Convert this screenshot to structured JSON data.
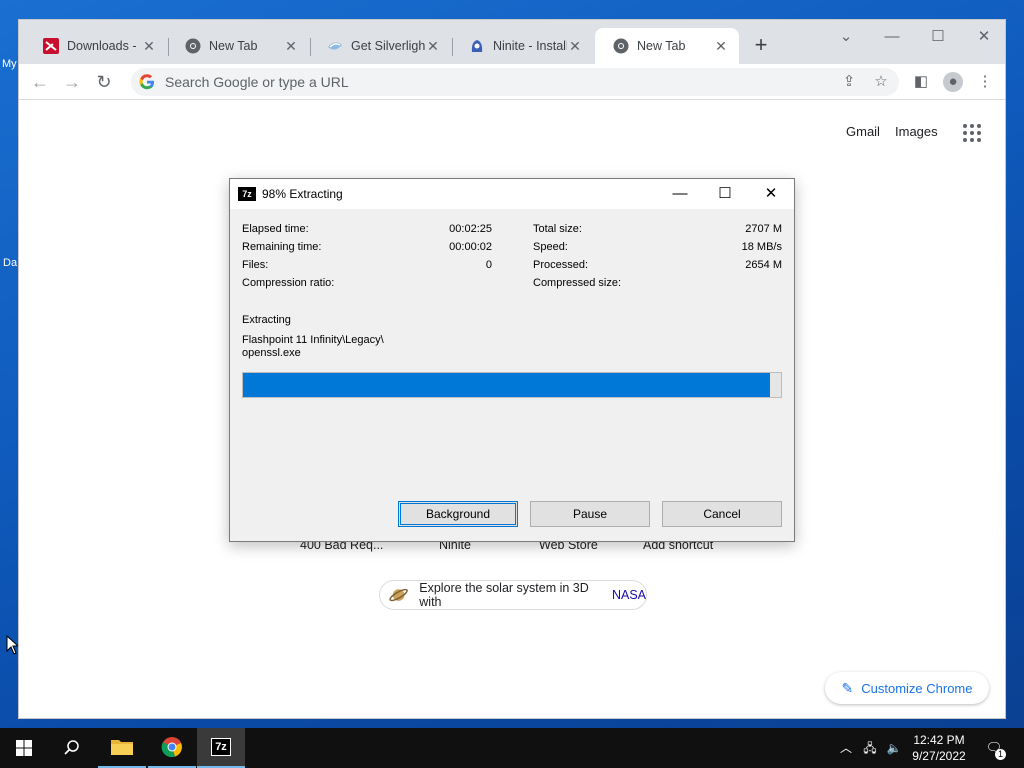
{
  "desktop": {
    "label_top": "My",
    "label_bottom": "Da"
  },
  "browser": {
    "tabs": [
      {
        "title": "Downloads - E",
        "favicon": "downloads-favicon",
        "active": false
      },
      {
        "title": "New Tab",
        "favicon": "chrome-favicon",
        "active": false
      },
      {
        "title": "Get Silverlight",
        "favicon": "silverlight-favicon",
        "active": false
      },
      {
        "title": "Ninite - Install",
        "favicon": "ninite-favicon",
        "active": false
      },
      {
        "title": "New Tab",
        "favicon": "chrome-favicon",
        "active": true
      }
    ],
    "omnibox": {
      "placeholder": "Search Google or type a URL",
      "value": ""
    },
    "ntp": {
      "gmail": "Gmail",
      "images": "Images",
      "shortcuts": [
        "400 Bad Req...",
        "Ninite",
        "Web Store",
        "Add shortcut"
      ],
      "promo_text": "Explore the solar system in 3D with",
      "promo_link": "NASA",
      "customize": "Customize Chrome"
    },
    "colors": {
      "accent": "#1a73e8",
      "tabstrip": "#dee1e6"
    }
  },
  "dialog": {
    "app_icon": "7z",
    "title": "98% Extracting",
    "stats_left": [
      {
        "label": "Elapsed time:",
        "value": "00:02:25"
      },
      {
        "label": "Remaining time:",
        "value": "00:00:02"
      },
      {
        "label": "Files:",
        "value": "0"
      },
      {
        "label": "Compression ratio:",
        "value": ""
      }
    ],
    "stats_right": [
      {
        "label": "Total size:",
        "value": "2707 M"
      },
      {
        "label": "Speed:",
        "value": "18 MB/s"
      },
      {
        "label": "Processed:",
        "value": "2654 M"
      },
      {
        "label": "Compressed size:",
        "value": ""
      }
    ],
    "operation": "Extracting",
    "current_path_line1": "Flashpoint 11 Infinity\\Legacy\\",
    "current_path_line2": "openssl.exe",
    "progress": 0.98,
    "buttons": {
      "background": "Background",
      "pause": "Pause",
      "cancel": "Cancel"
    },
    "colors": {
      "progress": "#0078d7"
    }
  },
  "taskbar": {
    "pinned": [
      "windows-start-icon",
      "search-icon",
      "file-explorer-icon",
      "chrome-icon",
      "7zip-icon"
    ],
    "tray_app_label": "7z",
    "time": "12:42 PM",
    "date": "9/27/2022",
    "notification_count": "1"
  }
}
